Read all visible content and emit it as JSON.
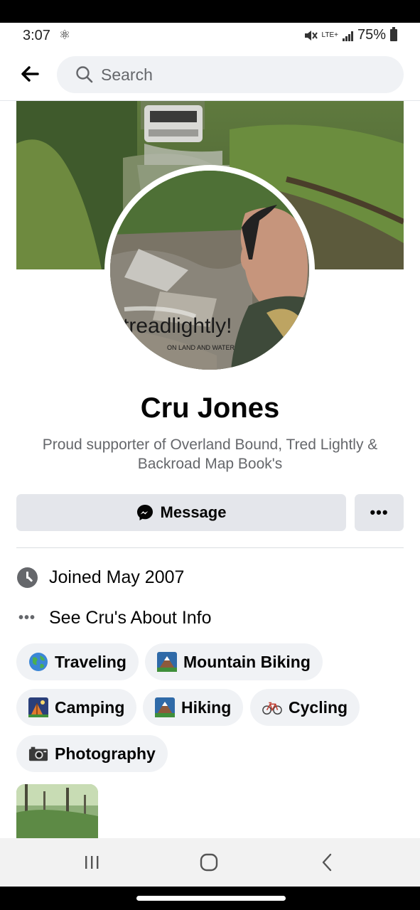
{
  "status": {
    "time": "3:07",
    "network": "LTE+",
    "battery": "75%"
  },
  "search": {
    "placeholder": "Search"
  },
  "profile": {
    "name": "Cru Jones",
    "bio": "Proud supporter of Overland Bound, Tred Lightly & Backroad Map Book's",
    "avatar_text_main": "treadlightly!",
    "avatar_text_sub": "ON LAND AND WATER"
  },
  "actions": {
    "message_label": "Message",
    "more_label": "•••"
  },
  "info": {
    "joined": "Joined May 2007",
    "about": "See Cru's About Info",
    "about_dots": "•••"
  },
  "interests": [
    {
      "label": "Traveling",
      "icon": "globe-icon"
    },
    {
      "label": "Mountain Biking",
      "icon": "mountain-icon"
    },
    {
      "label": "Camping",
      "icon": "camping-icon"
    },
    {
      "label": "Hiking",
      "icon": "mountain-icon"
    },
    {
      "label": "Cycling",
      "icon": "bicycle-icon"
    },
    {
      "label": "Photography",
      "icon": "camera-icon"
    }
  ],
  "colors": {
    "chip_bg": "#f0f2f5",
    "button_bg": "#e4e6eb",
    "secondary_text": "#65676b"
  }
}
